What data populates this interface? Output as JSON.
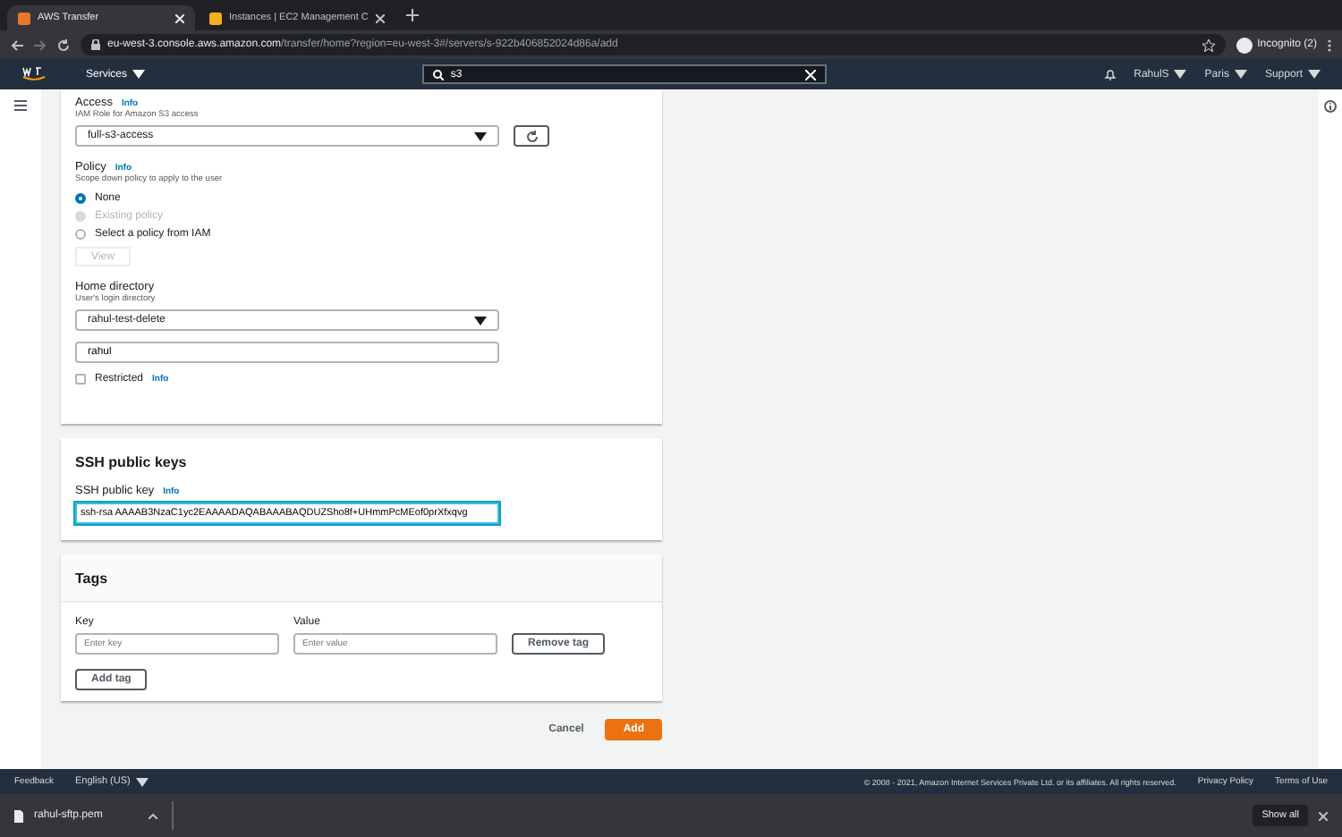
{
  "browser": {
    "tabs": [
      {
        "title": "AWS Transfer",
        "selected": true
      },
      {
        "title": "Instances | EC2 Management C",
        "selected": false
      }
    ],
    "url_host": "eu-west-3.console.aws.amazon.com",
    "url_path": "/transfer/home?region=eu-west-3#/servers/s-922b406852024d86a/add",
    "profile": "Incognito (2)"
  },
  "nav": {
    "services": "Services",
    "search": "s3",
    "user": "RahulS",
    "region": "Paris",
    "support": "Support"
  },
  "access": {
    "label": "Access",
    "info": "Info",
    "hint": "IAM Role for Amazon S3 access",
    "value": "full-s3-access"
  },
  "policy": {
    "label": "Policy",
    "info": "Info",
    "hint": "Scope down policy to apply to the user",
    "options": [
      {
        "label": "None",
        "selected": true,
        "disabled": false
      },
      {
        "label": "Existing policy",
        "selected": false,
        "disabled": true
      },
      {
        "label": "Select a policy from IAM",
        "selected": false,
        "disabled": false
      }
    ],
    "view_button": "View"
  },
  "home": {
    "label": "Home directory",
    "hint": "User's login directory",
    "bucket": "rahul-test-delete",
    "folder": "rahul",
    "restricted": {
      "label": "Restricted",
      "info": "Info",
      "checked": false
    }
  },
  "ssh": {
    "title": "SSH public keys",
    "label": "SSH public key",
    "info": "Info",
    "value": "ssh-rsa AAAAB3NzaC1yc2EAAAADAQABAAABAQDUZSho8f+UHmmPcMEof0prXfxqvg"
  },
  "tags": {
    "title": "Tags",
    "key_label": "Key",
    "value_label": "Value",
    "key_placeholder": "Enter key",
    "value_placeholder": "Enter value",
    "remove": "Remove tag",
    "add": "Add tag"
  },
  "actions": {
    "cancel": "Cancel",
    "add": "Add"
  },
  "footer": {
    "feedback": "Feedback",
    "language": "English (US)",
    "copyright": "© 2008 - 2021, Amazon Internet Services Private Ltd. or its affiliates. All rights reserved.",
    "privacy": "Privacy Policy",
    "terms": "Terms of Use"
  },
  "downloads": {
    "file": "rahul-sftp.pem",
    "show_all": "Show all"
  }
}
